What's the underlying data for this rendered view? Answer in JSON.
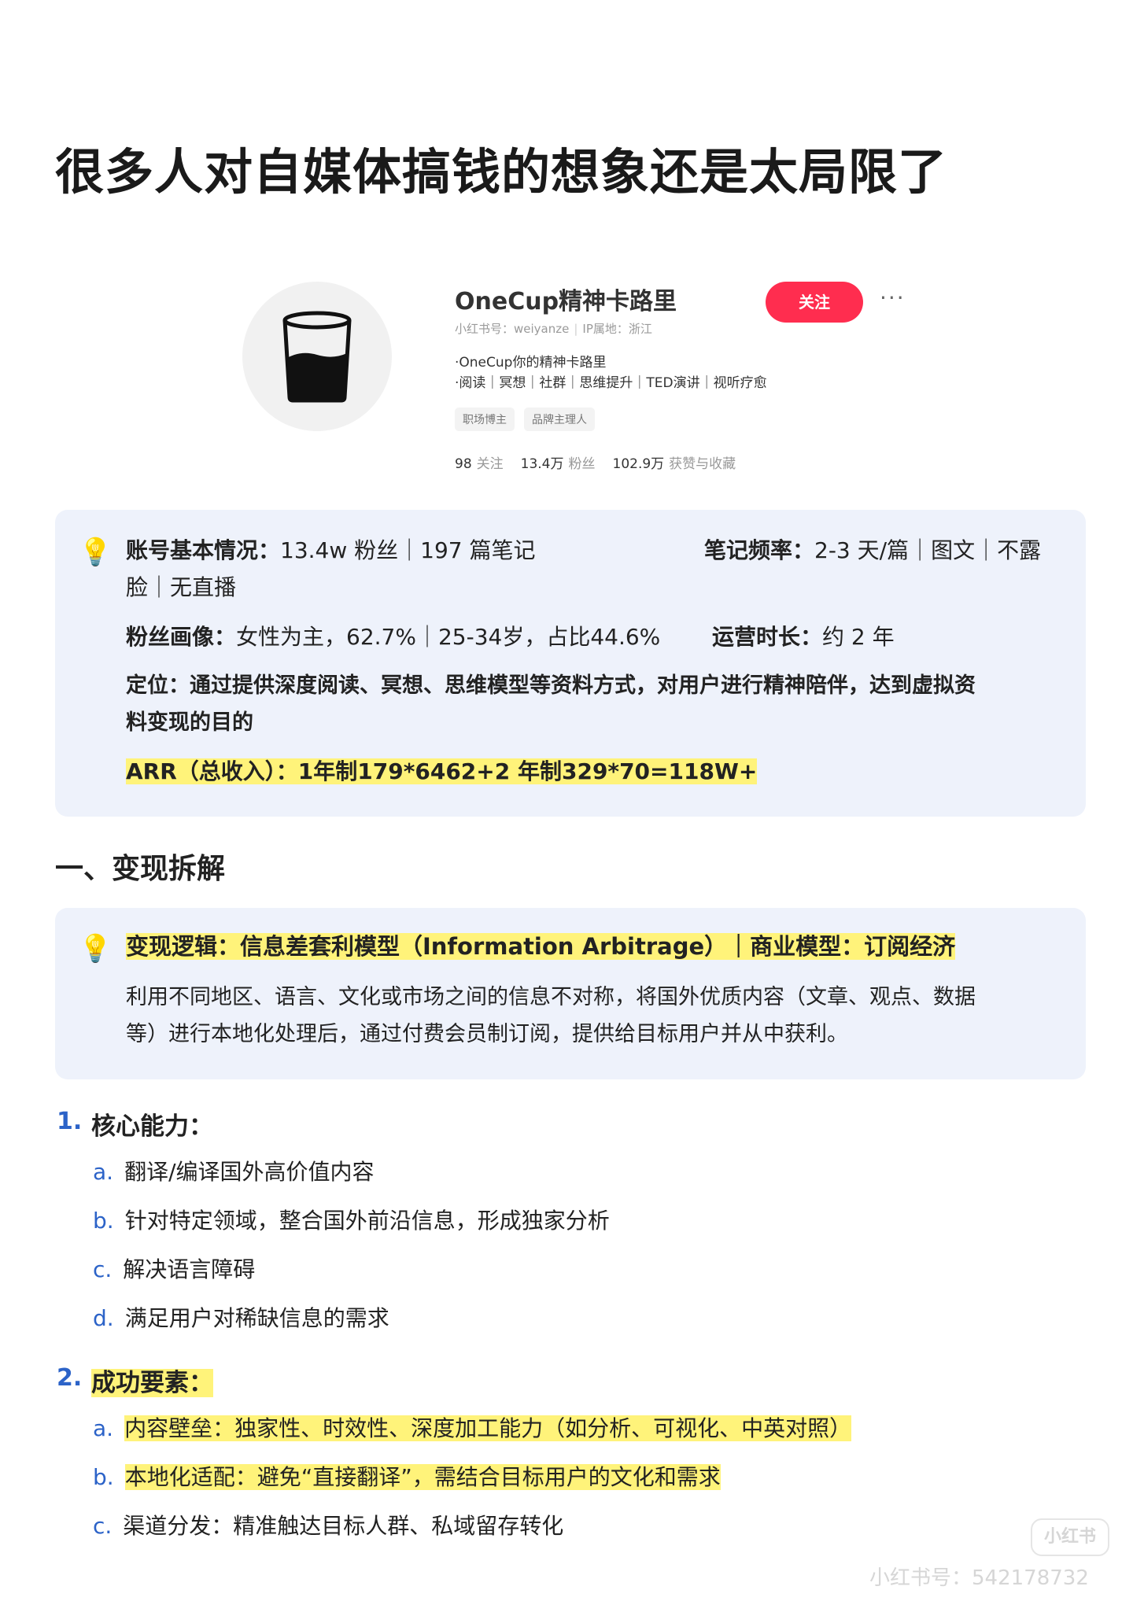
{
  "title": "很多人对自媒体搞钱的想象还是太局限了",
  "profile": {
    "name": "OneCup精神卡路里",
    "id_label": "小红书号：weiyanze",
    "ip_label": "IP属地：浙江",
    "follow_label": "关注",
    "more_label": "···",
    "bio_line1": "·OneCup你的精神卡路里",
    "bio_line2": "·阅读｜冥想｜社群｜思维提升｜TED演讲｜视听疗愈",
    "tags": [
      "职场博主",
      "品牌主理人"
    ],
    "stats": [
      {
        "value": "98",
        "label": "关注"
      },
      {
        "value": "13.4万",
        "label": "粉丝"
      },
      {
        "value": "102.9万",
        "label": "获赞与收藏"
      }
    ]
  },
  "info": {
    "row1_left_label": "账号基本情况：",
    "row1_left_value": "13.4w 粉丝｜197 篇笔记",
    "row1_right_label": "笔记频率：",
    "row1_right_value": "2-3 天/篇｜图文｜不露",
    "row1_cont": "脸｜无直播",
    "row2_left_label": "粉丝画像：",
    "row2_left_value": "女性为主，62.7%｜25-34岁，占比44.6%",
    "row2_right_label": "运营时长：",
    "row2_right_value": "约 2 年",
    "row3_line1": "定位：通过提供深度阅读、冥想、思维模型等资料方式，对用户进行精神陪伴，达到虚拟资",
    "row3_line2": "料变现的目的",
    "row4": "ARR（总收入）：1年制179*6462+2 年制329*70=118W+"
  },
  "section_title": "一、变现拆解",
  "logic": {
    "heading": "变现逻辑：信息差套利模型（Information Arbitrage）｜商业模型：订阅经济",
    "line1": "利用不同地区、语言、文化或市场之间的信息不对称，将国外优质内容（文章、观点、数据",
    "line2": "等）进行本地化处理后，通过付费会员制订阅，提供给目标用户并从中获利。"
  },
  "list1": {
    "num": "1.",
    "title": "核心能力：",
    "items": [
      {
        "letter": "a.",
        "text": "翻译/编译国外高价值内容"
      },
      {
        "letter": "b.",
        "text": "针对特定领域，整合国外前沿信息，形成独家分析"
      },
      {
        "letter": "c.",
        "text": "解决语言障碍"
      },
      {
        "letter": "d.",
        "text": "满足用户对稀缺信息的需求"
      }
    ]
  },
  "list2": {
    "num": "2.",
    "title": "成功要素：",
    "items": [
      {
        "letter": "a.",
        "text": "内容壁垒：独家性、时效性、深度加工能力（如分析、可视化、中英对照）"
      },
      {
        "letter": "b.",
        "text": "本地化适配：避免“直接翻译”，需结合目标用户的文化和需求"
      },
      {
        "letter": "c.",
        "text": "渠道分发：精准触达目标人群、私域留存转化"
      }
    ]
  },
  "watermark": {
    "logo": "小红书",
    "text": "小红书号：542178732"
  },
  "icons": {
    "bulb": "lightbulb-icon",
    "avatar": "cup-icon"
  },
  "colors": {
    "accent_red": "#ff2d4f",
    "list_blue": "#2c63c8",
    "highlight_yellow": "#fff37a",
    "box_bg": "#eef2fb"
  }
}
